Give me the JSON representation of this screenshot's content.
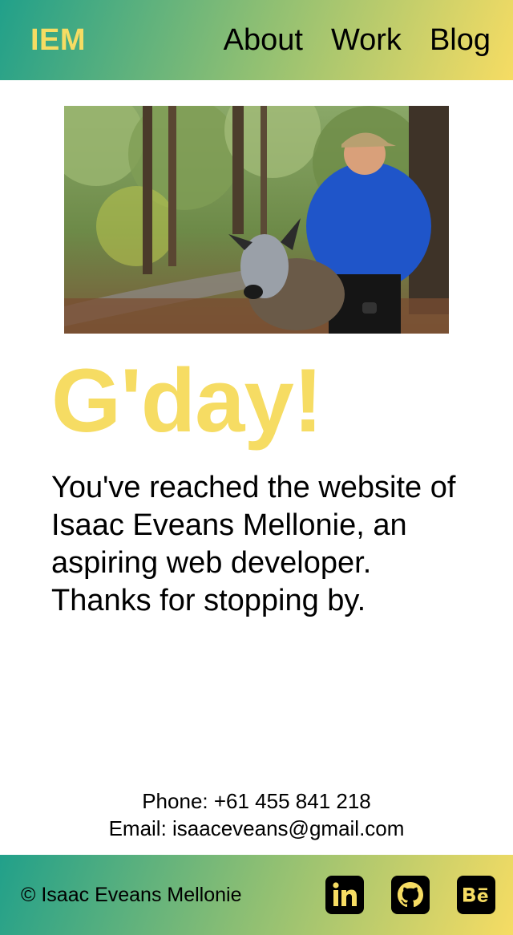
{
  "header": {
    "logo": "IEM",
    "nav": [
      {
        "label": "About"
      },
      {
        "label": "Work"
      },
      {
        "label": "Blog"
      }
    ]
  },
  "hero": {
    "photo_alt": "Isaac crouching with his dog in an autumn forest",
    "greeting": "G'day!",
    "intro": "You've reached the website of Isaac Eveans Mellonie, an aspiring web developer. Thanks for stopping by."
  },
  "contact": {
    "phone": "Phone: +61 455 841 218",
    "email": "Email: isaaceveans@gmail.com"
  },
  "footer": {
    "copyright": "© Isaac Eveans Mellonie",
    "socials": [
      {
        "icon": "linkedin-icon"
      },
      {
        "icon": "github-icon"
      },
      {
        "icon": "behance-icon"
      }
    ]
  },
  "colors": {
    "accent_yellow": "#f6dc63",
    "gradient_start": "#21a08a",
    "gradient_end": "#f6dc63"
  }
}
